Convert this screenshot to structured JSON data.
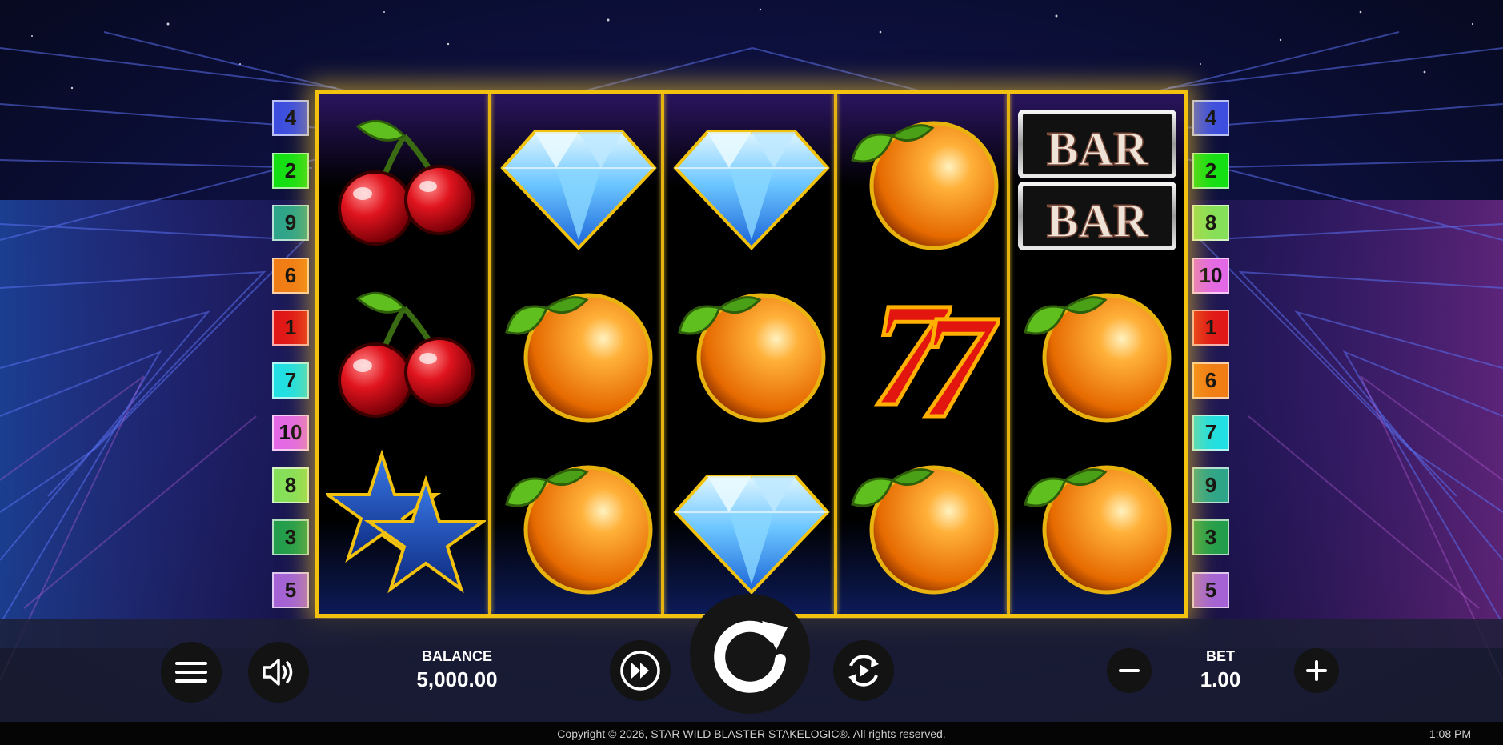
{
  "game": {
    "paylines_left": [
      {
        "n": "4",
        "color": "#3d4fe0"
      },
      {
        "n": "2",
        "color": "#14e014"
      },
      {
        "n": "9",
        "color": "#2ea58a"
      },
      {
        "n": "6",
        "color": "#f07d16"
      },
      {
        "n": "1",
        "color": "#e01818"
      },
      {
        "n": "7",
        "color": "#21e0e3"
      },
      {
        "n": "10",
        "color": "#e369e6"
      },
      {
        "n": "8",
        "color": "#86e05a"
      },
      {
        "n": "3",
        "color": "#239e4c"
      },
      {
        "n": "5",
        "color": "#a463d6"
      }
    ],
    "paylines_right": [
      {
        "n": "4",
        "color": "#3d4fe0"
      },
      {
        "n": "2",
        "color": "#14e014"
      },
      {
        "n": "8",
        "color": "#86e05a"
      },
      {
        "n": "10",
        "color": "#e369e6"
      },
      {
        "n": "1",
        "color": "#e01818"
      },
      {
        "n": "6",
        "color": "#f07d16"
      },
      {
        "n": "7",
        "color": "#21e0e3"
      },
      {
        "n": "9",
        "color": "#2ea58a"
      },
      {
        "n": "3",
        "color": "#239e4c"
      },
      {
        "n": "5",
        "color": "#a463d6"
      }
    ],
    "reels": [
      [
        "cherry",
        "cherry",
        "star"
      ],
      [
        "diamond",
        "orange",
        "orange"
      ],
      [
        "diamond",
        "orange",
        "diamond"
      ],
      [
        "orange",
        "seven",
        "orange"
      ],
      [
        "bar-bar",
        "orange",
        "orange"
      ]
    ],
    "bar_text": "BAR",
    "seven_text": "7"
  },
  "controls": {
    "menu_icon": "menu-icon",
    "sound_icon": "speaker-icon",
    "turbo_icon": "fast-forward-icon",
    "spin_icon": "spin-arrow-icon",
    "autoplay_icon": "autoplay-icon",
    "minus_icon": "minus-icon",
    "plus_icon": "plus-icon",
    "balance_label": "BALANCE",
    "balance_value": "5,000.00",
    "bet_label": "BET",
    "bet_value": "1.00"
  },
  "footer": {
    "copyright": "Copyright © 2026, STAR WILD BLASTER STAKELOGIC®. All rights reserved.",
    "time": "1:08 PM"
  },
  "colors": {
    "frame_gold": "#f2c20f",
    "background": "#070a24"
  }
}
